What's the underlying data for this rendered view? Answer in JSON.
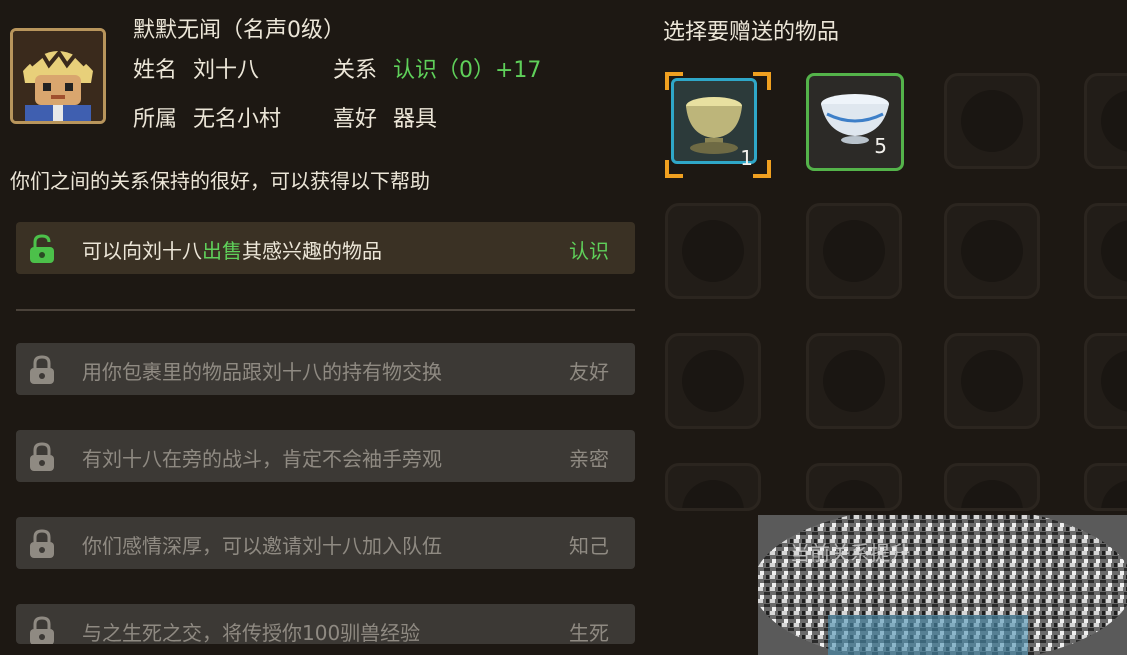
{
  "character": {
    "title": "默默无闻（名声0级）",
    "name_label": "姓名",
    "name_value": "刘十八",
    "relation_label": "关系",
    "relation_value": "认识（0）+17",
    "faction_label": "所属",
    "faction_value": "无名小村",
    "hobby_label": "喜好",
    "hobby_value": "器具"
  },
  "intro": "你们之间的关系保持的很好，可以获得以下帮助",
  "help_items": [
    {
      "text_before": "可以向刘十八",
      "text_highlight": "出售",
      "text_after": "其感兴趣的物品",
      "level": "认识",
      "unlocked": true
    },
    {
      "text": "用你包裹里的物品跟刘十八的持有物交换",
      "level": "友好",
      "unlocked": false
    },
    {
      "text": "有刘十八在旁的战斗，肯定不会袖手旁观",
      "level": "亲密",
      "unlocked": false
    },
    {
      "text": "你们感情深厚，可以邀请刘十八加入队伍",
      "level": "知己",
      "unlocked": false
    },
    {
      "text": "与之生死之交，将传授你100驯兽经验",
      "level": "生死",
      "unlocked": false
    }
  ],
  "gift": {
    "title": "选择要赠送的物品",
    "items": [
      {
        "icon": "bronze-bowl-icon",
        "count": "1",
        "selected": true
      },
      {
        "icon": "porcelain-bowl-icon",
        "count": "5",
        "selected": false
      }
    ]
  },
  "blurred_label": "当前关系提升"
}
